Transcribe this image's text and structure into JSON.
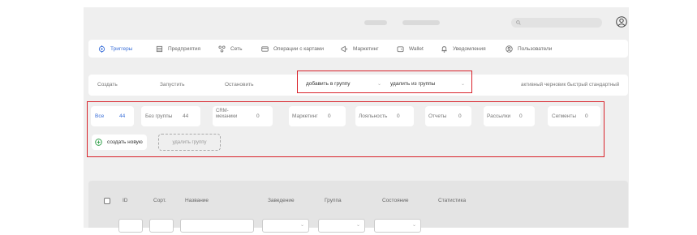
{
  "nav": {
    "items": [
      {
        "label": "Триггеры",
        "icon": "target-icon",
        "active": true
      },
      {
        "label": "Предприятия",
        "icon": "building-icon",
        "active": false
      },
      {
        "label": "Сеть",
        "icon": "network-icon",
        "active": false
      },
      {
        "label": "Операции с картами",
        "icon": "card-icon",
        "active": false
      },
      {
        "label": "Маркетинг",
        "icon": "megaphone-icon",
        "active": false
      },
      {
        "label": "Wallet",
        "icon": "wallet-icon",
        "active": false
      },
      {
        "label": "Уведомления",
        "icon": "bell-icon",
        "active": false
      },
      {
        "label": "Пользователи",
        "icon": "users-icon",
        "active": false
      }
    ]
  },
  "actions": {
    "create": "Создать",
    "start": "Запустить",
    "stop": "Остановить",
    "add_to_group": "добавить в группу",
    "remove_from_group": "удалить из группы",
    "status_filters": "активный черновик быстрый стандартный"
  },
  "groups": [
    {
      "label": "Все",
      "count": "44",
      "active": true
    },
    {
      "label": "Без группы",
      "count": "44",
      "active": false
    },
    {
      "label": "CRM-\nмеханики",
      "count": "0",
      "active": false
    },
    {
      "label": "Маркетинг",
      "count": "0",
      "active": false
    },
    {
      "label": "Лояльность",
      "count": "0",
      "active": false
    },
    {
      "label": "Отчеты",
      "count": "0",
      "active": false
    },
    {
      "label": "Рассылки",
      "count": "0",
      "active": false
    },
    {
      "label": "Сегменты",
      "count": "0",
      "active": false
    }
  ],
  "group_actions": {
    "create_new": "создать новую",
    "delete_group": "удалить группу"
  },
  "table": {
    "columns": [
      "ID",
      "Сорт.",
      "Название",
      "Заведение",
      "Группа",
      "Состояние",
      "Статистика"
    ]
  },
  "colors": {
    "accent": "#3a6fd8",
    "highlight": "#d9222a",
    "success": "#2e9e47"
  }
}
